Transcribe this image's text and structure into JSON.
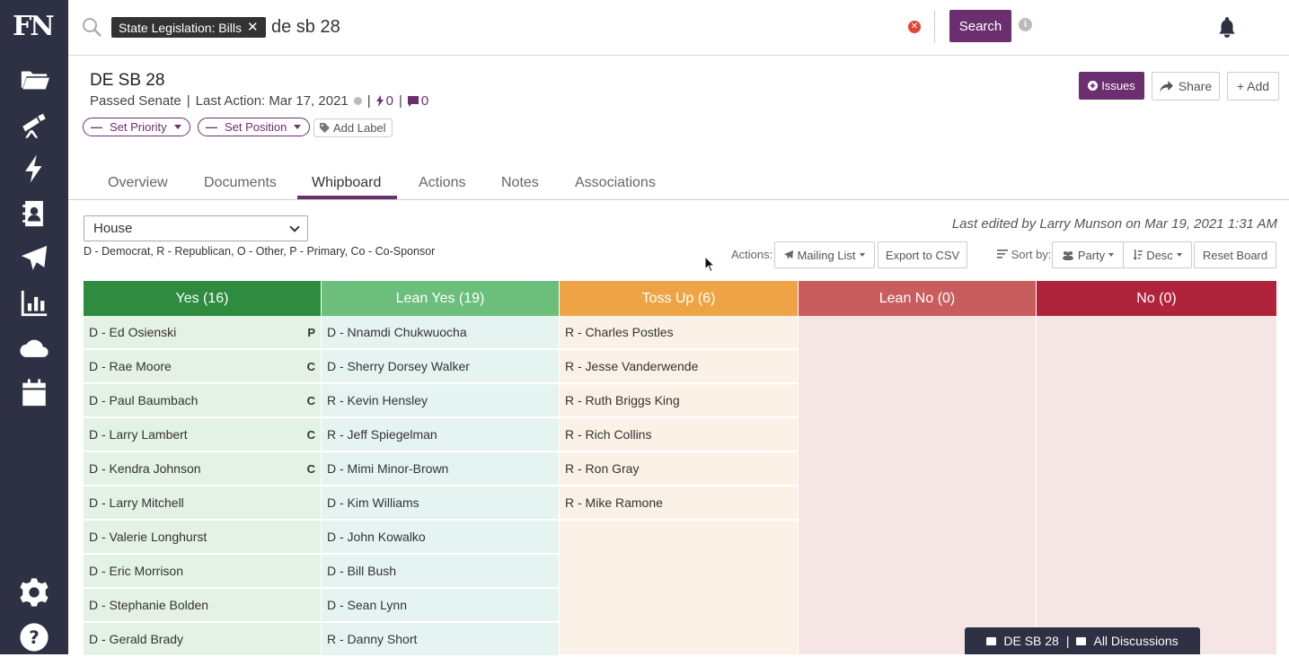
{
  "brand": {
    "logo": "FN"
  },
  "sidebar": {
    "icons": [
      "folder-icon",
      "telescope-icon",
      "bolt-icon",
      "contacts-icon",
      "paper-plane-icon",
      "bar-chart-icon",
      "cloud-icon",
      "calendar-icon",
      "gear-icon",
      "help-icon"
    ]
  },
  "search": {
    "filter_label": "State Legislation: Bills",
    "query": "de sb 28",
    "search_label": "Search"
  },
  "bill": {
    "title": "DE SB 28",
    "status": "Passed Senate",
    "last_action": "Last Action: Mar 17, 2021",
    "bolt_count": "0",
    "note_count": "0",
    "set_priority": "Set Priority",
    "set_position": "Set Position",
    "add_label": "Add Label"
  },
  "header_buttons": {
    "issues": "Issues",
    "share": "Share",
    "add": "+ Add"
  },
  "tabs": [
    "Overview",
    "Documents",
    "Whipboard",
    "Actions",
    "Notes",
    "Associations"
  ],
  "active_tab": "Whipboard",
  "whipboard": {
    "chamber": "House",
    "legend": "D - Democrat, R - Republican, O - Other, P - Primary, Co - Co-Sponsor",
    "last_edited": "Last edited by Larry Munson on Mar 19, 2021 1:31 AM",
    "actions_label": "Actions:",
    "mailing_list": "Mailing List",
    "export_csv": "Export to CSV",
    "sort_label": "Sort by:",
    "sort_field": "Party",
    "sort_order": "Desc",
    "reset": "Reset Board",
    "columns": [
      {
        "title": "Yes (16)",
        "head_color": "#2e8b3f",
        "body_color": "#e4f1e5",
        "members": [
          {
            "name": "D - Ed Osienski",
            "tag": "P"
          },
          {
            "name": "D - Rae Moore",
            "tag": "C"
          },
          {
            "name": "D - Paul Baumbach",
            "tag": "C"
          },
          {
            "name": "D - Larry Lambert",
            "tag": "C"
          },
          {
            "name": "D - Kendra Johnson",
            "tag": "C"
          },
          {
            "name": "D - Larry Mitchell",
            "tag": ""
          },
          {
            "name": "D - Valerie Longhurst",
            "tag": ""
          },
          {
            "name": "D - Eric Morrison",
            "tag": ""
          },
          {
            "name": "D - Stephanie Bolden",
            "tag": ""
          },
          {
            "name": "D - Gerald Brady",
            "tag": ""
          }
        ]
      },
      {
        "title": "Lean Yes (19)",
        "head_color": "#6bbf7a",
        "body_color": "#e6f4f1",
        "members": [
          {
            "name": "D - Nnamdi Chukwuocha",
            "tag": ""
          },
          {
            "name": "D - Sherry Dorsey Walker",
            "tag": ""
          },
          {
            "name": "R - Kevin Hensley",
            "tag": ""
          },
          {
            "name": "R - Jeff Spiegelman",
            "tag": ""
          },
          {
            "name": "D - Mimi Minor-Brown",
            "tag": ""
          },
          {
            "name": "D - Kim Williams",
            "tag": ""
          },
          {
            "name": "D - John Kowalko",
            "tag": ""
          },
          {
            "name": "D - Bill Bush",
            "tag": ""
          },
          {
            "name": "D - Sean Lynn",
            "tag": ""
          },
          {
            "name": "R - Danny Short",
            "tag": ""
          }
        ]
      },
      {
        "title": "Toss Up (6)",
        "head_color": "#eea444",
        "body_color": "#fbf1e6",
        "members": [
          {
            "name": "R - Charles Postles",
            "tag": ""
          },
          {
            "name": "R - Jesse Vanderwende",
            "tag": ""
          },
          {
            "name": "R - Ruth Briggs King",
            "tag": ""
          },
          {
            "name": "R - Rich Collins",
            "tag": ""
          },
          {
            "name": "R - Ron Gray",
            "tag": ""
          },
          {
            "name": "R - Mike Ramone",
            "tag": ""
          }
        ]
      },
      {
        "title": "Lean No (0)",
        "head_color": "#c95d5d",
        "body_color": "#f6e5e5",
        "members": []
      },
      {
        "title": "No (0)",
        "head_color": "#b0243b",
        "body_color": "#f6e5e5",
        "members": []
      }
    ]
  },
  "discussion_bar": {
    "bill": "DE SB 28",
    "all": "All Discussions"
  }
}
